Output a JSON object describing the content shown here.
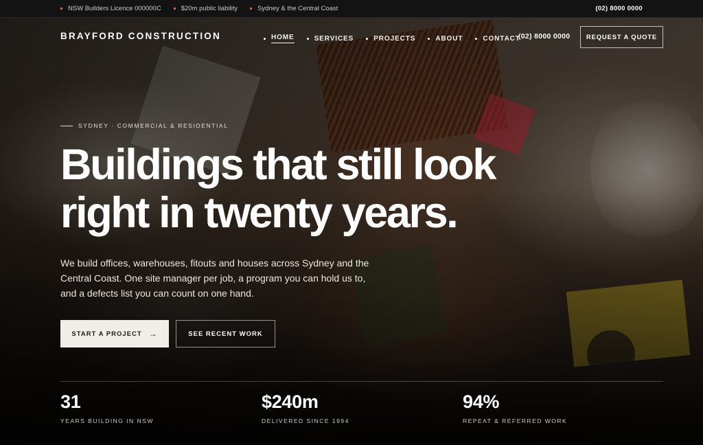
{
  "topbar": {
    "items": [
      "NSW Builders Licence 000000C",
      "$20m public liability",
      "Sydney & the Central Coast"
    ],
    "phone": "(02) 8000 0000"
  },
  "nav": {
    "brand": "BRAYFORD CONSTRUCTION",
    "links": [
      "HOME",
      "SERVICES",
      "PROJECTS",
      "ABOUT",
      "CONTACT"
    ],
    "active": "HOME",
    "phone": "(02) 8000 0000",
    "cta": "REQUEST A QUOTE"
  },
  "hero": {
    "eyebrow": "SYDNEY · COMMERCIAL & RESIDENTIAL",
    "headline_line1": "Buildings that still look",
    "headline_line2": "right in twenty years.",
    "lead": "We build offices, warehouses, fitouts and houses across Sydney and the Central Coast. One site manager per job, a program you can hold us to, and a defects list you can count on one hand.",
    "primary_cta": "START A PROJECT",
    "secondary_cta": "SEE RECENT WORK"
  },
  "stats": [
    {
      "value": "31",
      "label": "YEARS BUILDING IN NSW"
    },
    {
      "value": "$240m",
      "label": "DELIVERED SINCE 1994"
    },
    {
      "value": "94%",
      "label": "REPEAT & REFERRED WORK"
    }
  ],
  "colors": {
    "accent": "#d9652b",
    "topbar_bg": "#131313",
    "primary_button_bg": "#f1eee8"
  },
  "icons": {
    "primary_cta_arrow": "arrow-right-icon"
  }
}
